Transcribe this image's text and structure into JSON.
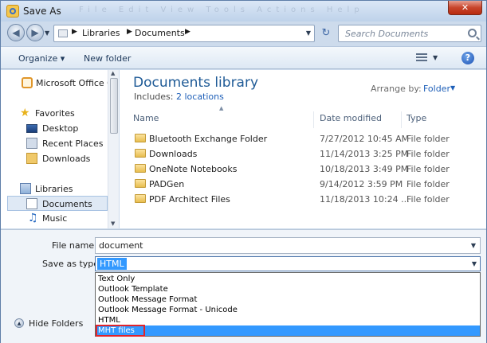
{
  "window": {
    "title": "Save As",
    "ghost_menu": "File  Edit  View  Tools  Actions  Help",
    "close_glyph": "✕"
  },
  "nav": {
    "back_glyph": "◀",
    "forward_glyph": "▶",
    "breadcrumb": [
      "Libraries",
      "Documents"
    ],
    "refresh_glyph": "↻",
    "search_placeholder": "Search Documents"
  },
  "toolbar": {
    "organize": "Organize ▾",
    "new_folder": "New folder",
    "help_glyph": "?"
  },
  "sidebar": {
    "items": [
      {
        "label": "Microsoft Office Ou",
        "icon": "office-icon"
      },
      {
        "label": "Favorites",
        "icon": "star-icon"
      },
      {
        "label": "Desktop",
        "icon": "desktop-icon"
      },
      {
        "label": "Recent Places",
        "icon": "recent-places-icon"
      },
      {
        "label": "Downloads",
        "icon": "downloads-icon"
      },
      {
        "label": "Libraries",
        "icon": "library-icon"
      },
      {
        "label": "Documents",
        "icon": "documents-icon"
      },
      {
        "label": "Music",
        "icon": "music-icon"
      }
    ]
  },
  "library": {
    "title": "Documents library",
    "includes_label": "Includes:",
    "includes_link": "2 locations",
    "arrange_label": "Arrange by:",
    "arrange_value": "Folder"
  },
  "columns": {
    "name": "Name",
    "date": "Date modified",
    "type": "Type"
  },
  "files": [
    {
      "name": "Bluetooth Exchange Folder",
      "date": "7/27/2012 10:45 AM",
      "type": "File folder"
    },
    {
      "name": "Downloads",
      "date": "11/14/2013 3:25 PM",
      "type": "File folder"
    },
    {
      "name": "OneNote Notebooks",
      "date": "10/18/2013 3:49 PM",
      "type": "File folder"
    },
    {
      "name": "PADGen",
      "date": "9/14/2012 3:59 PM",
      "type": "File folder"
    },
    {
      "name": "PDF Architect Files",
      "date": "11/18/2013 10:24 ...",
      "type": "File folder"
    }
  ],
  "form": {
    "file_name_label": "File name:",
    "file_name_value": "document",
    "save_type_label": "Save as type:",
    "save_type_value": "HTML",
    "type_options": [
      "Text Only",
      "Outlook Template",
      "Outlook Message Format",
      "Outlook Message Format - Unicode",
      "HTML",
      "MHT files"
    ],
    "highlighted_option": "MHT files",
    "hide_folders": "Hide Folders"
  }
}
